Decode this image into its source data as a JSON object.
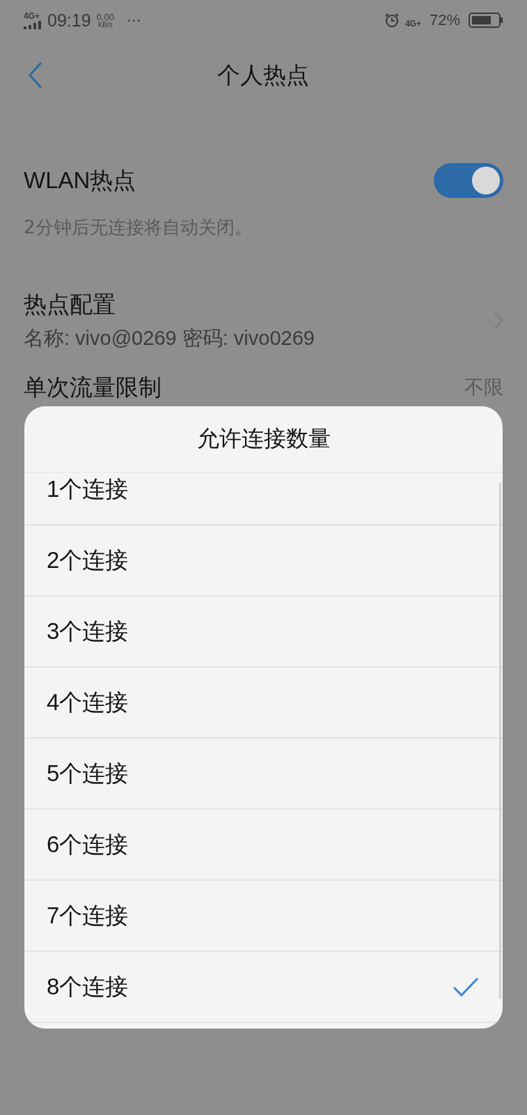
{
  "status_bar": {
    "network_left": "4G+",
    "time": "09:19",
    "speed_value": "0.00",
    "speed_unit": "KB/s",
    "more": "···",
    "network_right": "4G+",
    "battery": "72%"
  },
  "header": {
    "title": "个人热点"
  },
  "settings": [
    {
      "kind": "toggle",
      "label": "WLAN热点",
      "on": true
    },
    {
      "kind": "note",
      "label": "2分钟后无连接将自动关闭。"
    },
    {
      "kind": "link",
      "label": "热点配置",
      "detail": "名称: vivo@0269  密码: vivo0269"
    },
    {
      "kind": "value",
      "label": "单次流量限制",
      "value": "不限"
    }
  ],
  "dialog": {
    "title": "允许连接数量",
    "options": [
      {
        "label": "1个连接",
        "selected": false
      },
      {
        "label": "2个连接",
        "selected": false
      },
      {
        "label": "3个连接",
        "selected": false
      },
      {
        "label": "4个连接",
        "selected": false
      },
      {
        "label": "5个连接",
        "selected": false
      },
      {
        "label": "6个连接",
        "selected": false
      },
      {
        "label": "7个连接",
        "selected": false
      },
      {
        "label": "8个连接",
        "selected": true
      }
    ]
  }
}
